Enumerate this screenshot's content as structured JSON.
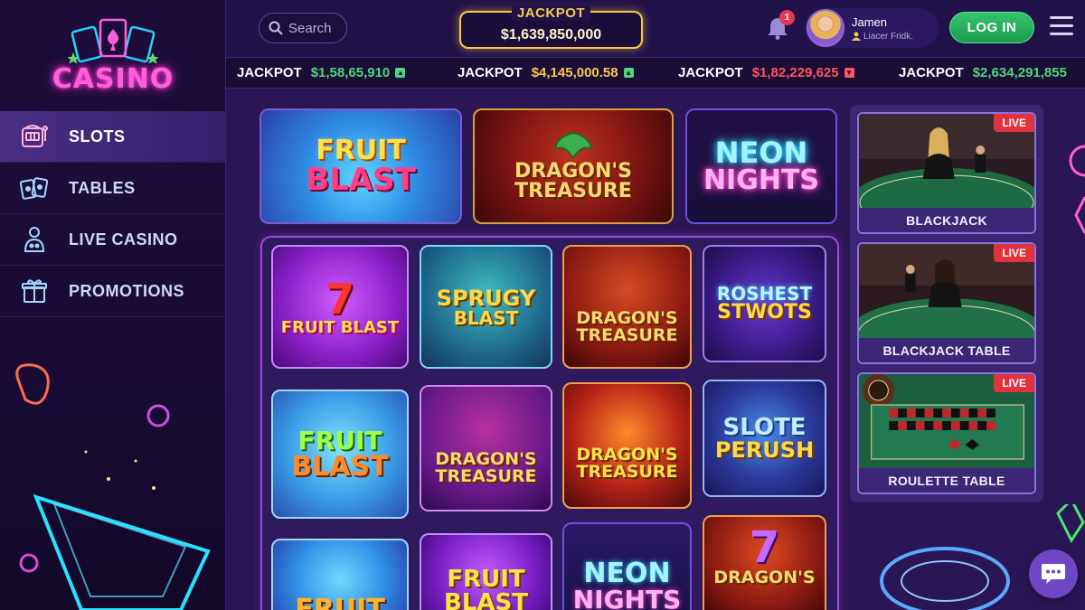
{
  "brand": {
    "logo_text": "CASINO"
  },
  "sidebar": {
    "items": [
      {
        "label": "SLOTS",
        "icon": "slot-machine-icon",
        "active": true
      },
      {
        "label": "TABLES",
        "icon": "cards-icon",
        "active": false
      },
      {
        "label": "LIVE CASINO",
        "icon": "dealer-icon",
        "active": false
      },
      {
        "label": "PROMOTIONS",
        "icon": "gift-icon",
        "active": false
      }
    ]
  },
  "header": {
    "search_placeholder": "Search",
    "jackpot_label": "JACKPOT",
    "jackpot_value": "$1,639,850,000",
    "notification_count": "1",
    "user_name": "Jamen",
    "user_sub": "Liacer Fridk.",
    "login_label": "LOG IN"
  },
  "ticker": [
    {
      "label": "JACKPOT",
      "amount": "$1,5⁡8,65,910",
      "color": "#4ed67a",
      "trend": "up"
    },
    {
      "label": "JACKPOT",
      "amount": "$4,145,000.58",
      "color": "#f7c948",
      "trend": "up"
    },
    {
      "label": "JACKPOT",
      "amount": "$1,82,229,625",
      "color": "#ff5563",
      "trend": "down"
    },
    {
      "label": "JACKPOT",
      "amount": "$2,634,291,855",
      "color": "#4ed67a",
      "trend": "up"
    }
  ],
  "featured": [
    {
      "title_line1": "FRUIT",
      "title_line2": "BLAST"
    },
    {
      "title_line1": "DRAGON'S",
      "title_line2": "TREASURE"
    },
    {
      "title_line1": "NEON",
      "title_line2": "NIGHTS"
    }
  ],
  "games": [
    {
      "title_line1": "7",
      "title_line2": "FRUIT BLAST"
    },
    {
      "title_line1": "SPRUGY",
      "title_line2": "BLAST"
    },
    {
      "title_line1": "DRAGON'S",
      "title_line2": "TREASURE"
    },
    {
      "title_line1": "ROSHEST",
      "title_line2": "STWOTS"
    },
    {
      "title_line1": "FRUIT",
      "title_line2": "BLAST"
    },
    {
      "title_line1": "DRAGON'S",
      "title_line2": "TREASURE"
    },
    {
      "title_line1": "DRAGON'S",
      "title_line2": "TREASURE"
    },
    {
      "title_line1": "SLOTE",
      "title_line2": "PERUSH"
    },
    {
      "title_line1": "FRUIT",
      "title_line2": ""
    },
    {
      "title_line1": "FRUIT",
      "title_line2": "BLAST"
    },
    {
      "title_line1": "NEON",
      "title_line2": "NIGHTS"
    },
    {
      "title_line1": "7",
      "title_line2": "DRAGON'S"
    }
  ],
  "live": [
    {
      "name": "BLACKJACK",
      "badge": "LIVE"
    },
    {
      "name": "BLACKJACK TABLE",
      "badge": "LIVE"
    },
    {
      "name": "ROULETTE TABLE",
      "badge": "LIVE"
    }
  ],
  "colors": {
    "accent_gold": "#f7c948",
    "login_green": "#35c46d",
    "neon_pink": "#ff5fd8",
    "live_red": "#e0323f"
  }
}
